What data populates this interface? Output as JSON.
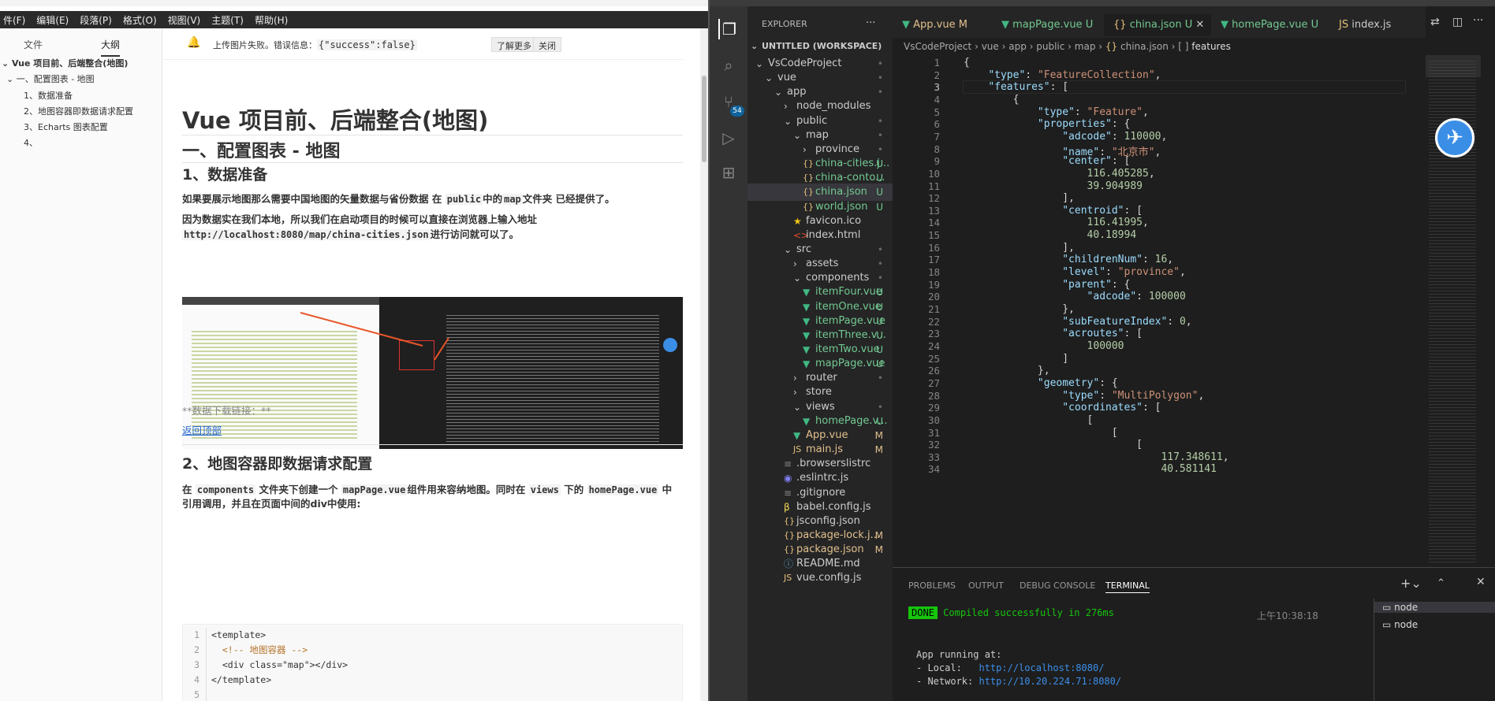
{
  "typora": {
    "menu": [
      "件(F)",
      "编辑(E)",
      "段落(P)",
      "格式(O)",
      "视图(V)",
      "主题(T)",
      "帮助(H)"
    ],
    "sidebar_tabs": {
      "files": "文件",
      "outline": "大纲"
    },
    "outline": [
      {
        "text": "Vue 项目前、后端整合(地图)"
      },
      {
        "text": "一、配置图表 - 地图"
      },
      {
        "text": "1、数据准备"
      },
      {
        "text": "2、地图容器即数据请求配置"
      },
      {
        "text": "3、Echarts 图表配置"
      },
      {
        "text": "4、"
      }
    ],
    "notice": {
      "text": "上传图片失败。错误信息：",
      "code": "{\"success\":false}",
      "learn_more": "了解更多",
      "close": "关闭"
    },
    "content": {
      "h1": "Vue 项目前、后端整合(地图)",
      "h2": "一、配置图表 - 地图",
      "h3a": "1、数据准备",
      "p1a": "如果要展示地图那么需要中国地图的矢量数据与省份数据 在",
      "p1code": "public",
      "p1b": "中的",
      "p1code2": "map",
      "p1c": "文件夹 已经提供了。",
      "p2a": "因为数据实在我们本地，所以我们在启动项目的时候可以直接在浏览器上输入地址",
      "p2code": "http://localhost:8080/map/china-cities.json",
      "p2b": "进行访问就可以了。",
      "download": "**数据下载链接：**",
      "back_top": "返回顶部",
      "h3b": "2、地图容器即数据请求配置",
      "p3a": "在",
      "p3code1": "components",
      "p3b": "文件夹下创建一个",
      "p3code2": "mapPage.vue",
      "p3c": "组件用来容纳地图。同时在",
      "p3code3": "views",
      "p3d": "下的",
      "p3code4": "homePage.vue",
      "p3e": "中",
      "p4": "引用调用，并且在页面中间的div中使用:",
      "code_lines": [
        "<template>",
        "  <!-- 地图容器 -->",
        "  <div class=\"map\"></div>",
        "</template>",
        ""
      ]
    }
  },
  "vscode": {
    "explorer_title": "EXPLORER",
    "workspace": "UNTITLED (WORKSPACE)",
    "tree": [
      {
        "name": "VsCodeProject",
        "status": "•"
      },
      {
        "name": "vue",
        "status": "•"
      },
      {
        "name": "app",
        "status": "•"
      },
      {
        "name": "node_modules",
        "status": ""
      },
      {
        "name": "public",
        "status": "•"
      },
      {
        "name": "map",
        "status": "•"
      },
      {
        "name": "province",
        "status": "•"
      },
      {
        "name": "china-cities.j...",
        "status": "U"
      },
      {
        "name": "china-conto...",
        "status": "U"
      },
      {
        "name": "china.json",
        "status": "U"
      },
      {
        "name": "world.json",
        "status": "U"
      },
      {
        "name": "favicon.ico",
        "status": ""
      },
      {
        "name": "index.html",
        "status": ""
      },
      {
        "name": "src",
        "status": "•"
      },
      {
        "name": "assets",
        "status": "•"
      },
      {
        "name": "components",
        "status": "•"
      },
      {
        "name": "itemFour.vue",
        "status": "U"
      },
      {
        "name": "itemOne.vue",
        "status": "U"
      },
      {
        "name": "itemPage.vue",
        "status": "U"
      },
      {
        "name": "itemThree.v...",
        "status": "U"
      },
      {
        "name": "itemTwo.vue",
        "status": "U"
      },
      {
        "name": "mapPage.vue",
        "status": "U"
      },
      {
        "name": "router",
        "status": "•"
      },
      {
        "name": "store",
        "status": ""
      },
      {
        "name": "views",
        "status": "•"
      },
      {
        "name": "homePage.v...",
        "status": "U"
      },
      {
        "name": "App.vue",
        "status": "M"
      },
      {
        "name": "main.js",
        "status": "M"
      },
      {
        "name": ".browserslistrc",
        "status": ""
      },
      {
        "name": ".eslintrc.js",
        "status": ""
      },
      {
        "name": ".gitignore",
        "status": ""
      },
      {
        "name": "babel.config.js",
        "status": ""
      },
      {
        "name": "jsconfig.json",
        "status": ""
      },
      {
        "name": "package-lock.j...",
        "status": "M"
      },
      {
        "name": "package.json",
        "status": "M"
      },
      {
        "name": "README.md",
        "status": ""
      },
      {
        "name": "vue.config.js",
        "status": ""
      }
    ],
    "tabs": [
      {
        "label": "App.vue",
        "status": "M"
      },
      {
        "label": "mapPage.vue",
        "status": "U"
      },
      {
        "label": "china.json",
        "status": "U"
      },
      {
        "label": "homePage.vue",
        "status": "U"
      },
      {
        "label": "index.js",
        "status": ""
      }
    ],
    "scm_badge": "54",
    "breadcrumb": [
      "VsCodeProject",
      "vue",
      "app",
      "public",
      "map",
      "china.json",
      "features"
    ],
    "code": [
      "{",
      "    \"type\": \"FeatureCollection\",",
      "    \"features\": [",
      "        {",
      "            \"type\": \"Feature\",",
      "            \"properties\": {",
      "                \"adcode\": 110000,",
      "                \"name\": \"北京市\",",
      "                \"center\": [",
      "                    116.405285,",
      "                    39.904989",
      "                ],",
      "                \"centroid\": [",
      "                    116.41995,",
      "                    40.18994",
      "                ],",
      "                \"childrenNum\": 16,",
      "                \"level\": \"province\",",
      "                \"parent\": {",
      "                    \"adcode\": 100000",
      "                },",
      "                \"subFeatureIndex\": 0,",
      "                \"acroutes\": [",
      "                    100000",
      "                ]",
      "            },",
      "            \"geometry\": {",
      "                \"type\": \"MultiPolygon\",",
      "                \"coordinates\": [",
      "                    [",
      "                        [",
      "                            [",
      "                                117.348611,",
      "                                40.581141"
    ],
    "panel_tabs": [
      "PROBLEMS",
      "OUTPUT",
      "DEBUG CONSOLE",
      "TERMINAL"
    ],
    "terminal": {
      "done": "DONE",
      "compiled": "Compiled successfully in 276ms",
      "time": "上午10:38:18",
      "running": "App running at:",
      "local_label": "- Local:   ",
      "local_url": "http://localhost:8080/",
      "network_label": "- Network: ",
      "network_url": "http://10.20.224.71:8080/"
    },
    "terminals": [
      "node",
      "node"
    ]
  }
}
